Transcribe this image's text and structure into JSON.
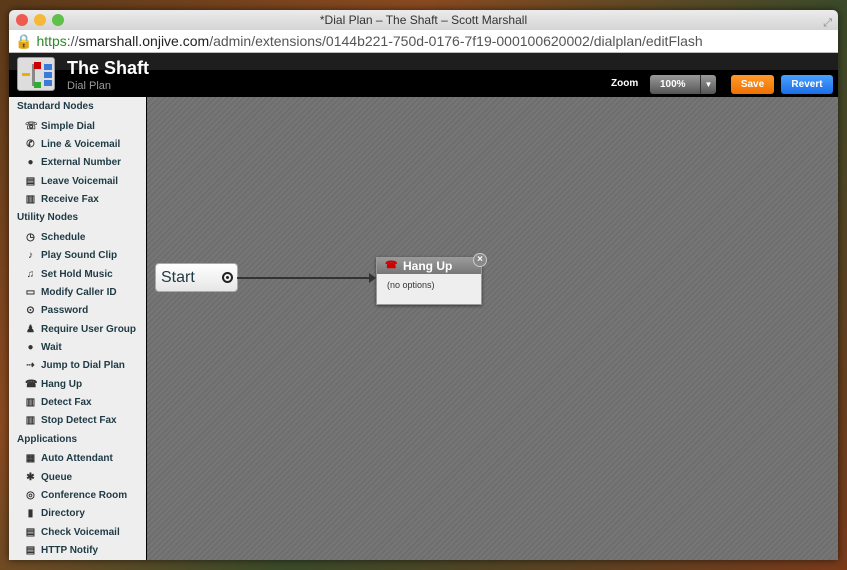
{
  "window": {
    "title": "*Dial Plan – The Shaft – Scott Marshall"
  },
  "url": {
    "scheme": "https",
    "sep": "://",
    "host": "smarshall.onjive.com",
    "path": "/admin/extensions/0144b221-750d-0176-7f19-000100620002/dialplan/editFlash"
  },
  "header": {
    "title": "The Shaft",
    "subtitle": "Dial Plan",
    "zoom_label": "Zoom",
    "zoom_value": "100%",
    "save": "Save",
    "revert": "Revert"
  },
  "colors": {
    "save": "#f07000",
    "revert": "#1a6ee8"
  },
  "sidebar": {
    "sections": [
      {
        "title": "Standard Nodes",
        "items": [
          {
            "label": "Simple Dial",
            "icon": "phone-icon"
          },
          {
            "label": "Line & Voicemail",
            "icon": "line-voicemail-icon"
          },
          {
            "label": "External Number",
            "icon": "external-number-icon"
          },
          {
            "label": "Leave Voicemail",
            "icon": "voicemail-icon"
          },
          {
            "label": "Receive Fax",
            "icon": "fax-icon"
          }
        ]
      },
      {
        "title": "Utility Nodes",
        "items": [
          {
            "label": "Schedule",
            "icon": "clock-icon"
          },
          {
            "label": "Play Sound Clip",
            "icon": "sound-icon"
          },
          {
            "label": "Set Hold Music",
            "icon": "music-icon"
          },
          {
            "label": "Modify Caller ID",
            "icon": "caller-id-icon"
          },
          {
            "label": "Password",
            "icon": "lock-icon"
          },
          {
            "label": "Require User Group",
            "icon": "user-group-icon"
          },
          {
            "label": "Wait",
            "icon": "bomb-timer-icon"
          },
          {
            "label": "Jump to Dial Plan",
            "icon": "jump-icon"
          },
          {
            "label": "Hang Up",
            "icon": "hang-up-icon"
          },
          {
            "label": "Detect Fax",
            "icon": "fax-icon"
          },
          {
            "label": "Stop Detect Fax",
            "icon": "fax-icon"
          }
        ]
      },
      {
        "title": "Applications",
        "items": [
          {
            "label": "Auto Attendant",
            "icon": "auto-attendant-icon"
          },
          {
            "label": "Queue",
            "icon": "queue-icon"
          },
          {
            "label": "Conference Room",
            "icon": "conference-icon"
          },
          {
            "label": "Directory",
            "icon": "directory-icon"
          },
          {
            "label": "Check Voicemail",
            "icon": "voicemail-icon"
          },
          {
            "label": "HTTP Notify",
            "icon": "http-icon"
          }
        ]
      }
    ]
  },
  "canvas": {
    "start_label": "Start",
    "node": {
      "title": "Hang Up",
      "body": "(no options)",
      "icon": "hang-up-icon"
    }
  }
}
